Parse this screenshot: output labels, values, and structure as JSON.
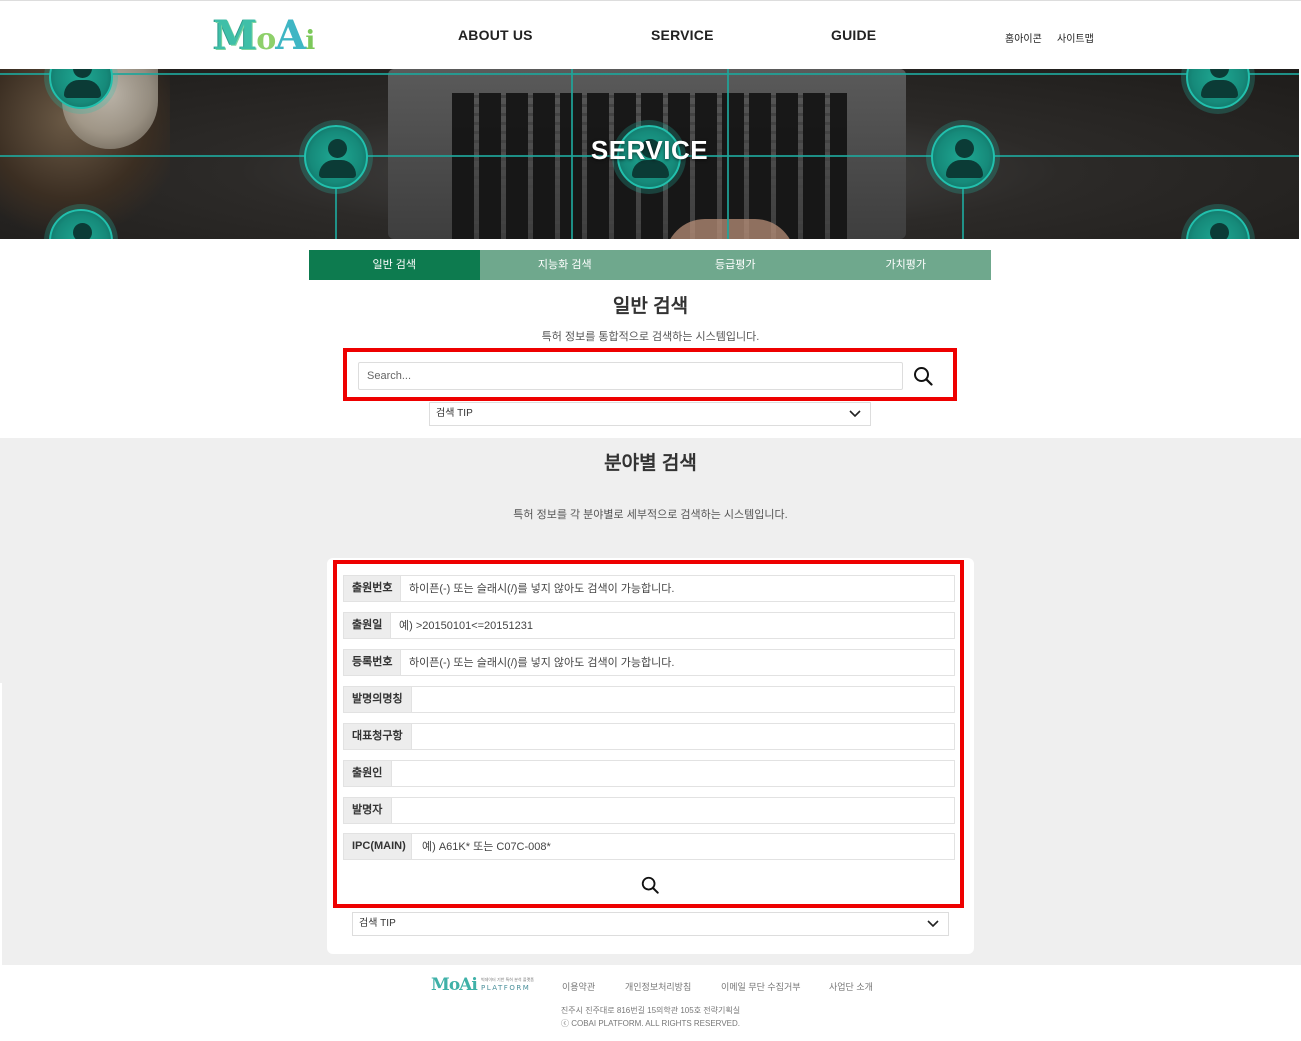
{
  "header": {
    "logo": {
      "p1": "M",
      "p2": "o",
      "p3": "A",
      "p4": "i"
    },
    "nav": [
      "ABOUT US",
      "SERVICE",
      "GUIDE"
    ],
    "util": [
      "홈아이콘",
      "사이트맵"
    ]
  },
  "banner": {
    "title": "SERVICE"
  },
  "tabs": [
    "일반 검색",
    "지능화 검색",
    "등급평가",
    "가치평가"
  ],
  "general_search": {
    "title": "일반 검색",
    "description": "특허 정보를 통합적으로 검색하는 시스템입니다.",
    "placeholder": "Search...",
    "tip_label": "검색 TIP"
  },
  "field_search": {
    "title": "분야별 검색",
    "description": "특허 정보를 각 분야별로 세부적으로 검색하는 시스템입니다.",
    "fields": [
      {
        "label": "출원번호",
        "placeholder": "하이픈(-) 또는 슬래시(/)를 넣지 않아도 검색이 가능합니다."
      },
      {
        "label": "출원일",
        "placeholder": "예) >20150101<=20151231"
      },
      {
        "label": "등록번호",
        "placeholder": "하이픈(-) 또는 슬래시(/)를 넣지 않아도 검색이 가능합니다."
      },
      {
        "label": "발명의명칭",
        "placeholder": ""
      },
      {
        "label": "대표청구항",
        "placeholder": ""
      },
      {
        "label": "출원인",
        "placeholder": ""
      },
      {
        "label": "발명자",
        "placeholder": ""
      },
      {
        "label": "IPC(MAIN)",
        "placeholder": "예) A61K* 또는 C07C-008*"
      }
    ],
    "tip_label": "검색 TIP"
  },
  "footer": {
    "logo": {
      "main": "MoAi",
      "sub": "빅데이터 기반 특허 분석 플랫폼",
      "platform": "PLATFORM"
    },
    "links": [
      "이용약관",
      "개인정보처리방침",
      "이메일 무단 수집거부",
      "사업단 소개"
    ],
    "address": "진주시 진주대로 816번길 15의학관 105호 전략기획실",
    "copyright": "ⓒ COBAI PLATFORM. ALL RIGHTS RESERVED."
  },
  "colors": {
    "tab_active": "#0d7b4f",
    "tab_inactive": "#6fa88d",
    "highlight": "#ee0000",
    "accent": "#1fa59a"
  }
}
